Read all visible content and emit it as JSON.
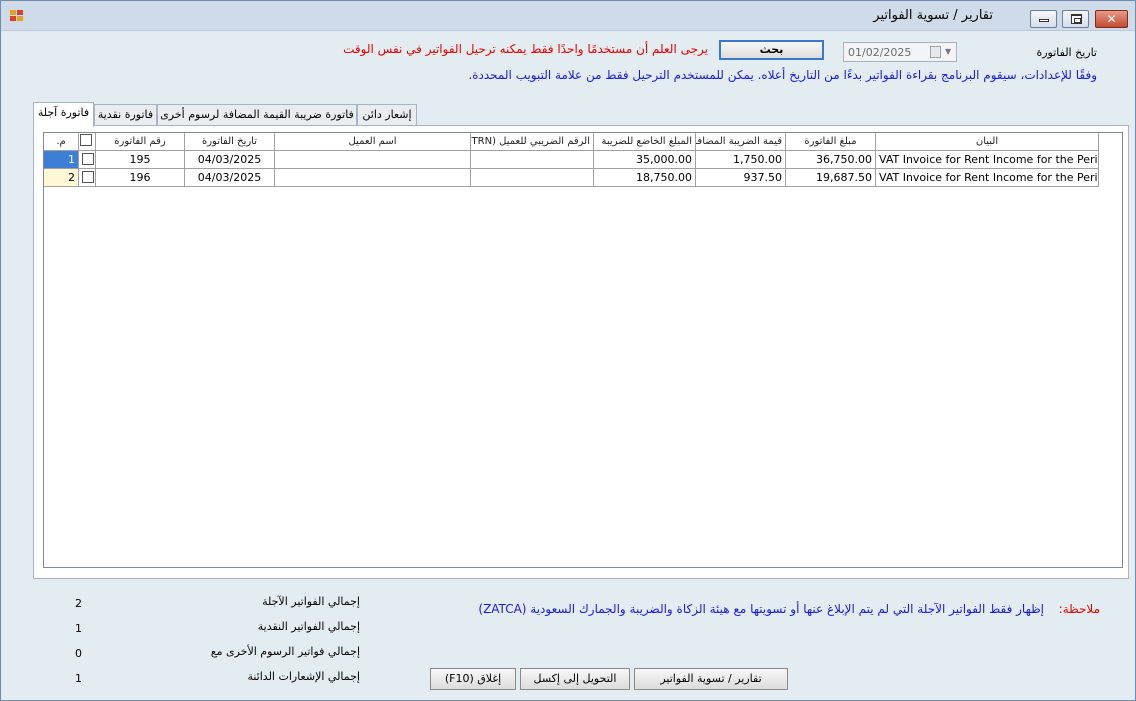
{
  "window": {
    "title": "تقارير / تسوية الفواتير"
  },
  "filter": {
    "date_label": "تاريخ الفاتورة",
    "date_value": "01/02/2025",
    "search_label": "بحث",
    "warning_text": "يرجى العلم أن مستخدمًا واحدًا فقط يمكنه ترحيل الفواتير في نفس الوقت",
    "info_text": "وفقًا للإعدادات، سيقوم البرنامج بقراءة الفواتير بدءًا من التاريخ أعلاه. يمكن للمستخدم الترحيل فقط من علامة التبويب المحددة."
  },
  "tabs": [
    {
      "label": "فاتورة آجلة",
      "active": true
    },
    {
      "label": "فاتورة نقدية",
      "active": false
    },
    {
      "label": "فاتورة ضريبة القيمة المضافة لرسوم أخرى",
      "active": false
    },
    {
      "label": "إشعار دائن",
      "active": false
    }
  ],
  "grid": {
    "columns": {
      "row_no": "م.",
      "invoice_no": "رقم الفاتورة",
      "invoice_date": "تاريخ الفاتورة",
      "customer_name": "اسم العميل",
      "trn": "الرقم الضريبي للعميل (TRN)",
      "taxable_amount": "المبلغ الخاضع للضريبة",
      "vat_amount": "قيمة الضريبة المضافة",
      "invoice_amount": "مبلغ الفاتورة",
      "description": "البيان"
    },
    "rows": [
      {
        "row_no": "1",
        "invoice_no": "195",
        "invoice_date": "04/03/2025",
        "customer_name": "",
        "trn": "",
        "taxable_amount": "35,000.00",
        "vat_amount": "1,750.00",
        "invoice_amount": "36,750.00",
        "description": "VAT Invoice for Rent Income for the Period"
      },
      {
        "row_no": "2",
        "invoice_no": "196",
        "invoice_date": "04/03/2025",
        "customer_name": "",
        "trn": "",
        "taxable_amount": "18,750.00",
        "vat_amount": "937.50",
        "invoice_amount": "19,687.50",
        "description": "VAT Invoice for Rent Income for the Period"
      }
    ]
  },
  "note": {
    "label": "ملاحظة:",
    "text": "إظهار فقط الفواتير الآجلة التي لم يتم الإبلاغ عنها أو تسويتها مع هيئة الزكاة والضريبة والجمارك السعودية (ZATCA)"
  },
  "summary": [
    {
      "label": "إجمالي الفواتير الآجلة",
      "value": "2"
    },
    {
      "label": "إجمالي الفواتير النقدية",
      "value": "1"
    },
    {
      "label": "إجمالي فواتير الرسوم الأخرى مع",
      "value": "0"
    },
    {
      "label": "إجمالي الإشعارات الدائنة",
      "value": "1"
    }
  ],
  "buttons": {
    "report": "تقارير / تسوية الفواتير",
    "export": "التحويل إلى إكسل",
    "close": "إغلاق (F10)"
  },
  "colors": {
    "warning": "#e60000",
    "info": "#1a1ad8",
    "selection": "#3c7fd4"
  }
}
